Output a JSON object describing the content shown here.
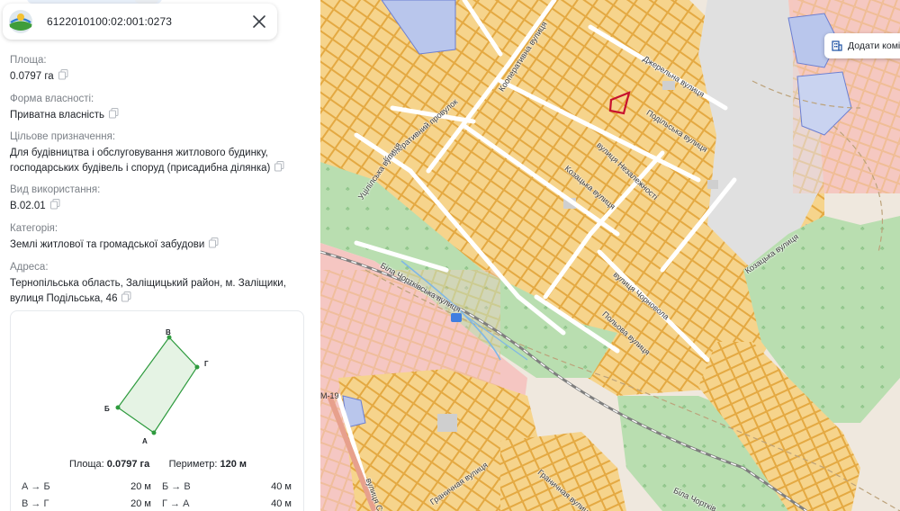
{
  "parcel": {
    "cadastral_number": "6122010100:02:001:0273"
  },
  "info": [
    {
      "label": "Площа:",
      "value": "0.0797 га"
    },
    {
      "label": "Форма власності:",
      "value": "Приватна власність"
    },
    {
      "label": "Цільове призначення:",
      "value_lines": [
        "Для будівництва і обслуговування житлового будинку,",
        "господарських будівель і споруд (присадибна ділянка)"
      ]
    },
    {
      "label": "Вид використання:",
      "value": "B.02.01"
    },
    {
      "label": "Категорія:",
      "value": "Землі житлової та громадської забудови"
    },
    {
      "label": "Адреса:",
      "value_lines": [
        "Тернопільська область, Заліщицький район, м. Заліщики,",
        "вулиця Подільська, 46"
      ]
    }
  ],
  "shape": {
    "vertices": [
      "В",
      "Г",
      "А",
      "Б"
    ],
    "area_label": "Площа:",
    "area_value": "0.0797 га",
    "perimeter_label": "Периметр:",
    "perimeter_value": "120 м",
    "sides": [
      {
        "name": "А → Б",
        "value": "20 м"
      },
      {
        "name": "Б → В",
        "value": "40 м"
      },
      {
        "name": "В → Г",
        "value": "20 м"
      },
      {
        "name": "Г → А",
        "value": "40 м"
      }
    ]
  },
  "map": {
    "add_button_label": "Додати комі",
    "road_label": "М-19",
    "street_labels": [
      "Кооперативна вулиця",
      "Джерельна вулиця",
      "Подільська вулиця",
      "Кооперативний провулок",
      "вулиця Незалежності",
      "Козацька вулиця",
      "Уцілілська вулиця",
      "Козацька вулиця",
      "Біла Чортківська вулиця",
      "вулиця Чорновола",
      "Польова вулиця",
      "Граничная вулиця",
      "Граничная вулиця",
      "вулиця Ст",
      "Біла Чортків"
    ]
  },
  "colors": {
    "parcel_fill": "#f6d48c",
    "parcel_stroke": "#e3a53a",
    "selected_parcel": "#c8102e",
    "green_area": "#b9deb0",
    "shape_stroke": "#2e9b3e"
  }
}
